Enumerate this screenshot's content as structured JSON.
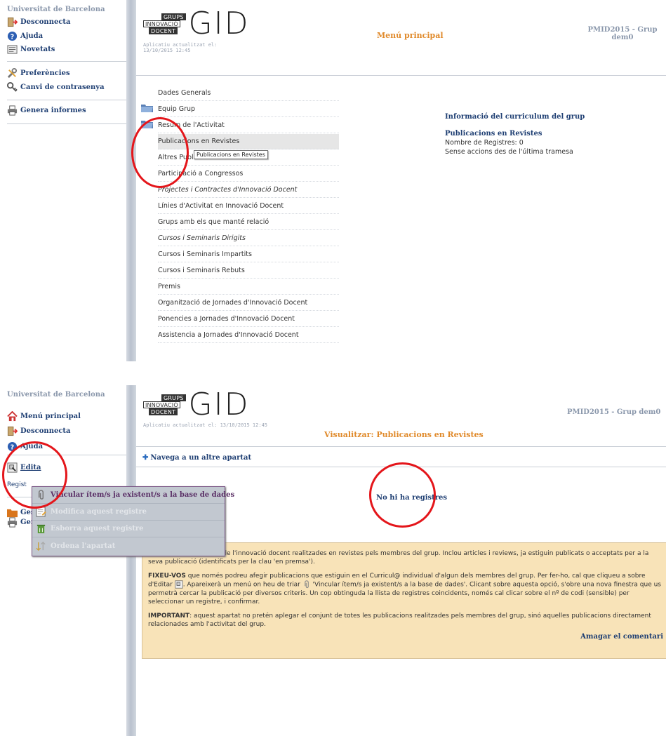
{
  "panel1": {
    "university": "Universitat de Barcelona",
    "sidebar": [
      {
        "label": "Desconnecta",
        "icon": "logout-icon"
      },
      {
        "label": "Ajuda",
        "icon": "help-icon"
      },
      {
        "label": "Novetats",
        "icon": "news-icon"
      },
      {
        "label": "Preferències",
        "icon": "tools-icon"
      },
      {
        "label": "Canvi de contrasenya",
        "icon": "key-icon"
      },
      {
        "label": "Genera informes",
        "icon": "printer-icon"
      }
    ],
    "logo": {
      "line1": "GRUPS",
      "line2": "INNOVACIÓ",
      "line3": "DOCENT",
      "big": "GID"
    },
    "updated_line1": "Aplicatiu actualitzat el:",
    "updated_line2": "13/10/2015 12:45",
    "header_title": "Menú principal",
    "header_group_line1": "PMID2015 - Grup",
    "header_group_line2": "dem0",
    "menu": [
      "Dades Generals",
      "Equip Grup",
      "Resum de l'Activitat",
      "Publicacions en Revistes",
      "Altres Publicacions",
      "Participació a Congressos",
      "Projectes i Contractes d'Innovació Docent",
      "Línies d'Activitat en Innovació Docent",
      "Grups amb els que manté relació",
      "Cursos i Seminaris Dirigits",
      "Cursos i Seminaris Impartits",
      "Cursos i Seminaris Rebuts",
      "Premis",
      "Organització de Jornades d'Innovació Docent",
      "Ponencies a Jornades d'Innovació Docent",
      "Assistencia a Jornades d'Innovació Docent"
    ],
    "tooltip": "Publicacions en Revistes",
    "info": {
      "title": "Informació del curriculum del grup",
      "subtitle": "Publicacions en Revistes",
      "records": "Nombre de Registres: 0",
      "actions": "Sense accions des de l'última tramesa"
    }
  },
  "panel2": {
    "university": "Universitat de Barcelona",
    "sidebar": [
      {
        "label": "Menú principal",
        "icon": "home-icon"
      },
      {
        "label": "Desconnecta",
        "icon": "logout-icon"
      },
      {
        "label": "Ajuda",
        "icon": "help-icon"
      },
      {
        "label": "Edita",
        "icon": "edit-icon"
      },
      {
        "label": "Regist",
        "icon": ""
      },
      {
        "label": "Ges",
        "icon": "folder-icon"
      },
      {
        "label": "Genera informes",
        "icon": "printer-icon"
      }
    ],
    "updated": "Aplicatiu actualitzat el: 13/10/2015 12:45",
    "header_title": "Visualitzar: Publicacions en Revistes",
    "header_group": "PMID2015 - Grup dem0",
    "nav_link": "Navega a un altre apartat",
    "no_records": "No hi ha registres",
    "popup": [
      {
        "label": "Vincular ítem/s ja existent/s a la base de dades",
        "state": "active"
      },
      {
        "label": "Modifica aquest registre",
        "state": "disabled"
      },
      {
        "label": "Esborra aquest registre",
        "state": "disabled"
      },
      {
        "label": "Ordena l'apartat",
        "state": "disabled"
      }
    ],
    "comment": {
      "p1": "Publicacions en l'àmbit de l'innovació docent realitzades en revistes pels membres del grup. Inclou articles i reviews, ja estiguin publicats o acceptats per a la seva publicació (identificats per la clau 'en premsa').",
      "p2_strong": "FIXEU-VOS",
      "p2_a": " que només podreu afegir publicacions que estiguin en el Curricul@ individual d'algun dels membres del grup. Per fer-ho, cal que cliqueu a sobre d'Editar ",
      "p2_b": ". Apareixerà un menú on heu de triar ",
      "p2_c": " 'Vincular ítem/s ja existent/s a la base de dades'. Clicant sobre aquesta opció, s'obre una nova finestra que us permetrà cercar la publicació per diversos criteris. Un cop obtinguda la llista de registres coincidents, només cal clicar sobre el nº de codi (sensible) per seleccionar un registre, i confirmar.",
      "p3_strong": "IMPORTANT",
      "p3": ": aquest apartat no pretén aplegar el conjunt de totes les publicacions realitzades pels membres del grup, sinó aquelles publicacions directament relacionades amb l'activitat del grup.",
      "hide": "Amagar el comentari"
    }
  }
}
